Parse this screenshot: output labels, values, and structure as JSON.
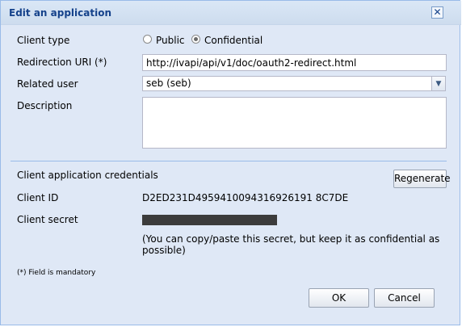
{
  "window": {
    "title": "Edit an application",
    "close_symbol": "✕"
  },
  "form": {
    "client_type": {
      "label": "Client type",
      "options": [
        {
          "label": "Public",
          "selected": false
        },
        {
          "label": "Confidential",
          "selected": true
        }
      ]
    },
    "redirection_uri": {
      "label": "Redirection URI (*)",
      "value": "http://ivapi/api/v1/doc/oauth2-redirect.html"
    },
    "related_user": {
      "label": "Related user",
      "value": "seb (seb)"
    },
    "description": {
      "label": "Description",
      "value": ""
    }
  },
  "credentials": {
    "section_title": "Client application credentials",
    "regenerate_label": "Regenerate",
    "client_id_label": "Client ID",
    "client_id_value": "D2ED231D4959410094316926191 8C7DE",
    "client_secret_label": "Client secret",
    "secret_note": "(You can copy/paste this secret, but keep it as confidential as possible)"
  },
  "footer": {
    "mandatory_note": "(*) Field is mandatory",
    "ok_label": "OK",
    "cancel_label": "Cancel"
  }
}
